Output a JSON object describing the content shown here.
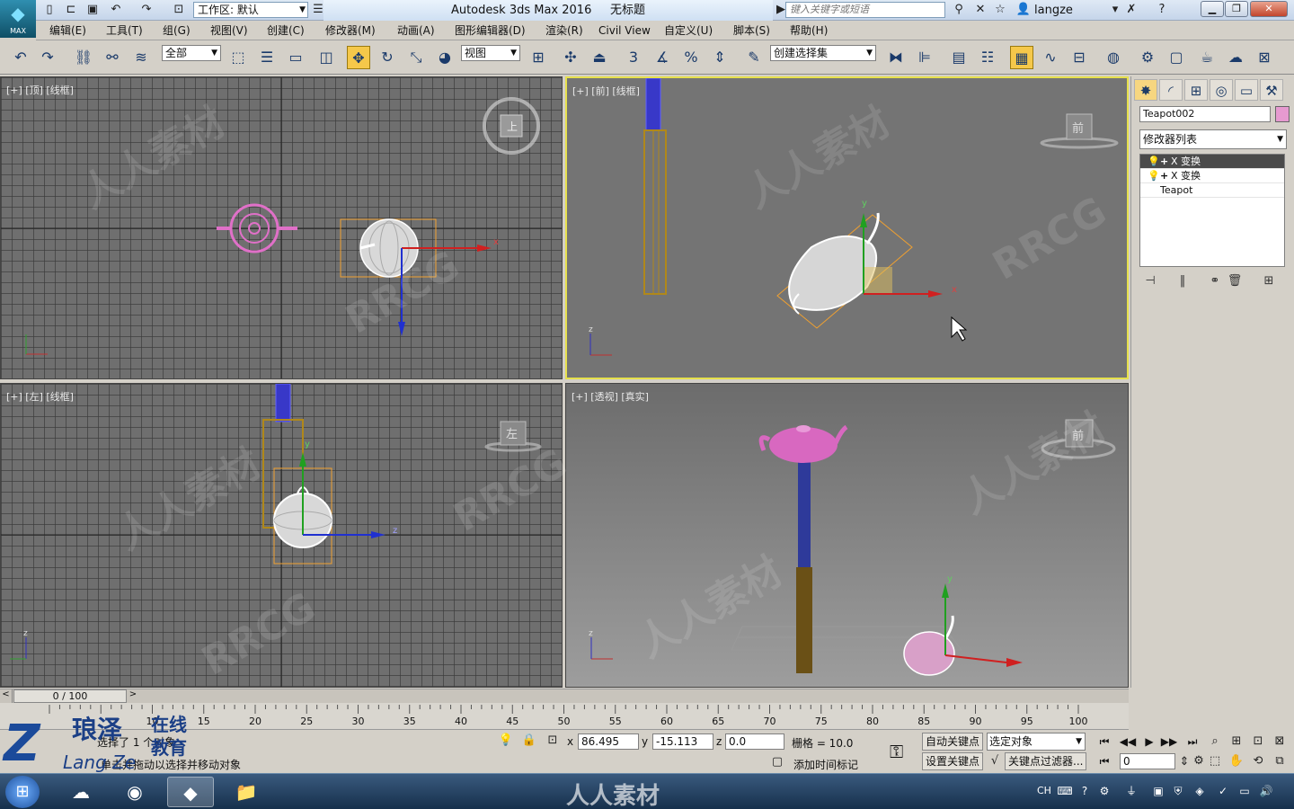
{
  "app": {
    "logo_text": "MAX",
    "title": "Autodesk 3ds Max 2016",
    "doc_title": "无标题",
    "workspace": "工作区: 默认",
    "search_placeholder": "键入关键字或短语",
    "user": "langze"
  },
  "menu": [
    {
      "label": "编辑(E)"
    },
    {
      "label": "工具(T)"
    },
    {
      "label": "组(G)"
    },
    {
      "label": "视图(V)"
    },
    {
      "label": "创建(C)"
    },
    {
      "label": "修改器(M)"
    },
    {
      "label": "动画(A)"
    },
    {
      "label": "图形编辑器(D)"
    },
    {
      "label": "渲染(R)"
    },
    {
      "label": "Civil View"
    },
    {
      "label": "自定义(U)"
    },
    {
      "label": "脚本(S)"
    },
    {
      "label": "帮助(H)"
    }
  ],
  "toolbar": {
    "filter": "全部",
    "ref_coord": "视图",
    "sel_set": "创建选择集",
    "snap_num": "3"
  },
  "viewports": {
    "top": {
      "label": "[+] [顶] [线框]",
      "cube_face": "上"
    },
    "front": {
      "label": "[+] [前] [线框]",
      "cube_face": "前"
    },
    "left": {
      "label": "[+] [左] [线框]",
      "cube_face": "左"
    },
    "persp": {
      "label": "[+] [透视] [真实]",
      "cube_face": "前"
    }
  },
  "axes": {
    "x": "x",
    "y": "y",
    "z": "z"
  },
  "command_panel": {
    "object_name": "Teapot002",
    "object_color": "#e69ad0",
    "modifier_list": "修改器列表",
    "stack": [
      {
        "label": "X 变换",
        "selected": true
      },
      {
        "label": "X 变换",
        "selected": false
      },
      {
        "label": "Teapot",
        "selected": false
      }
    ]
  },
  "time": {
    "slider": "0 / 100",
    "ticks": [
      10,
      15,
      20,
      25,
      30,
      35,
      40,
      45,
      50,
      55,
      60,
      65,
      70,
      75,
      80,
      85,
      90,
      95,
      100
    ]
  },
  "status": {
    "selected": "选择了 1 个对象",
    "prompt": "单击并拖动以选择并移动对象",
    "x": "86.495",
    "y": "-15.113",
    "z": "0.0",
    "grid": "栅格 = 10.0",
    "add_tag": "添加时间标记",
    "auto_key": "自动关键点",
    "set_key": "设置关键点",
    "selected_obj": "选定对象",
    "key_filter": "关键点过滤器...",
    "frame": "0"
  },
  "brand": {
    "mark": "Z",
    "name": "琅泽",
    "sub": "在线",
    "tag": "教育",
    "en": "Lang Ze"
  },
  "taskbar": {
    "brand": "人人素材",
    "lang": "CH"
  },
  "watermark": {
    "text1": "人人素材",
    "text2": "RRCG"
  },
  "colors": {
    "teapot_pink": "#e070c8",
    "selection": "#f0a030",
    "axis_x": "#d02020",
    "axis_y": "#20a020",
    "axis_z": "#2030d0",
    "active_border": "#e6e04c"
  }
}
